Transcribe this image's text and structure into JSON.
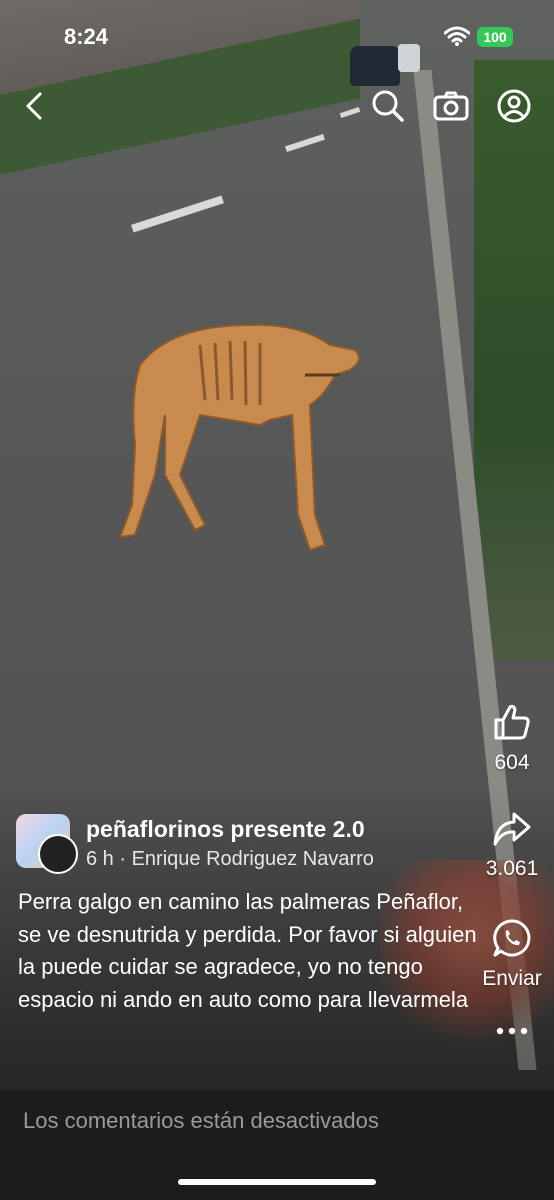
{
  "status_bar": {
    "time": "8:24",
    "battery": "100"
  },
  "topbar": {
    "back_icon": "chevron-left-icon",
    "search_icon": "search-icon",
    "camera_icon": "camera-icon",
    "profile_icon": "profile-icon"
  },
  "actions": {
    "like_count": "604",
    "share_count": "3.061",
    "send_label": "Enviar",
    "more_icon": "more-icon"
  },
  "post": {
    "page_name": "peñaflorinos presente 2.0",
    "meta": "6 h · Enrique Rodriguez Navarro",
    "caption": "Perra galgo en camino las palmeras Peñaflor, se ve desnutrida y perdida. Por favor si alguien la puede cuidar se agradece, yo no tengo espacio ni ando en auto como para llevarmela"
  },
  "comments": {
    "disabled_text": "Los comentarios están desactivados"
  },
  "colors": {
    "battery": "#35c759",
    "comments_bar": "#1c1c1c"
  }
}
